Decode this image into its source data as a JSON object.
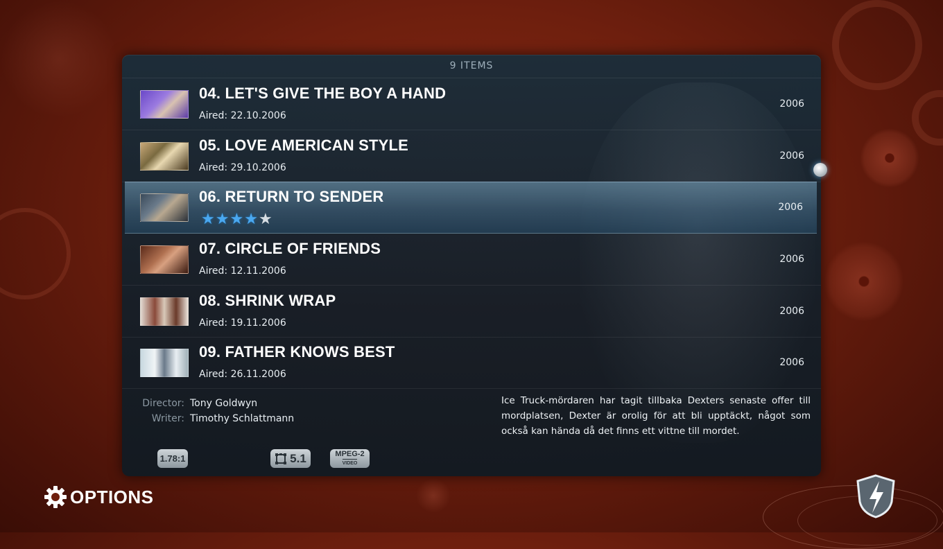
{
  "header": {
    "items_count": "9 ITEMS"
  },
  "episodes": [
    {
      "title": "04. LET'S GIVE THE BOY A HAND",
      "aired": "Aired: 22.10.2006",
      "year": "2006",
      "selected": false
    },
    {
      "title": "05. LOVE AMERICAN STYLE",
      "aired": "Aired: 29.10.2006",
      "year": "2006",
      "selected": false
    },
    {
      "title": "06. RETURN TO SENDER",
      "aired": "",
      "year": "2006",
      "selected": true,
      "rating": {
        "value": 4,
        "max": 5
      }
    },
    {
      "title": "07. CIRCLE OF FRIENDS",
      "aired": "Aired: 12.11.2006",
      "year": "2006",
      "selected": false
    },
    {
      "title": "08. SHRINK WRAP",
      "aired": "Aired: 19.11.2006",
      "year": "2006",
      "selected": false
    },
    {
      "title": "09. FATHER KNOWS BEST",
      "aired": "Aired: 26.11.2006",
      "year": "2006",
      "selected": false
    }
  ],
  "details": {
    "director_label": "Director:",
    "director": "Tony Goldwyn",
    "writer_label": "Writer:",
    "writer": "Timothy Schlattmann",
    "plot": "Ice Truck-mördaren har tagit tillbaka Dexters senaste offer till mordplatsen, Dexter är orolig för att bli upptäckt, något som också kan hända då det finns ett vittne till mordet."
  },
  "media_flags": {
    "aspect": "1.78:1",
    "audio_channels": "5.1",
    "video_codec_top": "MPEG-2",
    "video_codec_bottom": "VIDEO"
  },
  "footer": {
    "options_label": "OPTIONS",
    "options_icon": "gear-icon",
    "logo_icon": "lightning-shield-icon"
  },
  "colors": {
    "accent_blue": "#4aa8f0",
    "background": "#6e1f0e",
    "panel": "#182e3c"
  }
}
